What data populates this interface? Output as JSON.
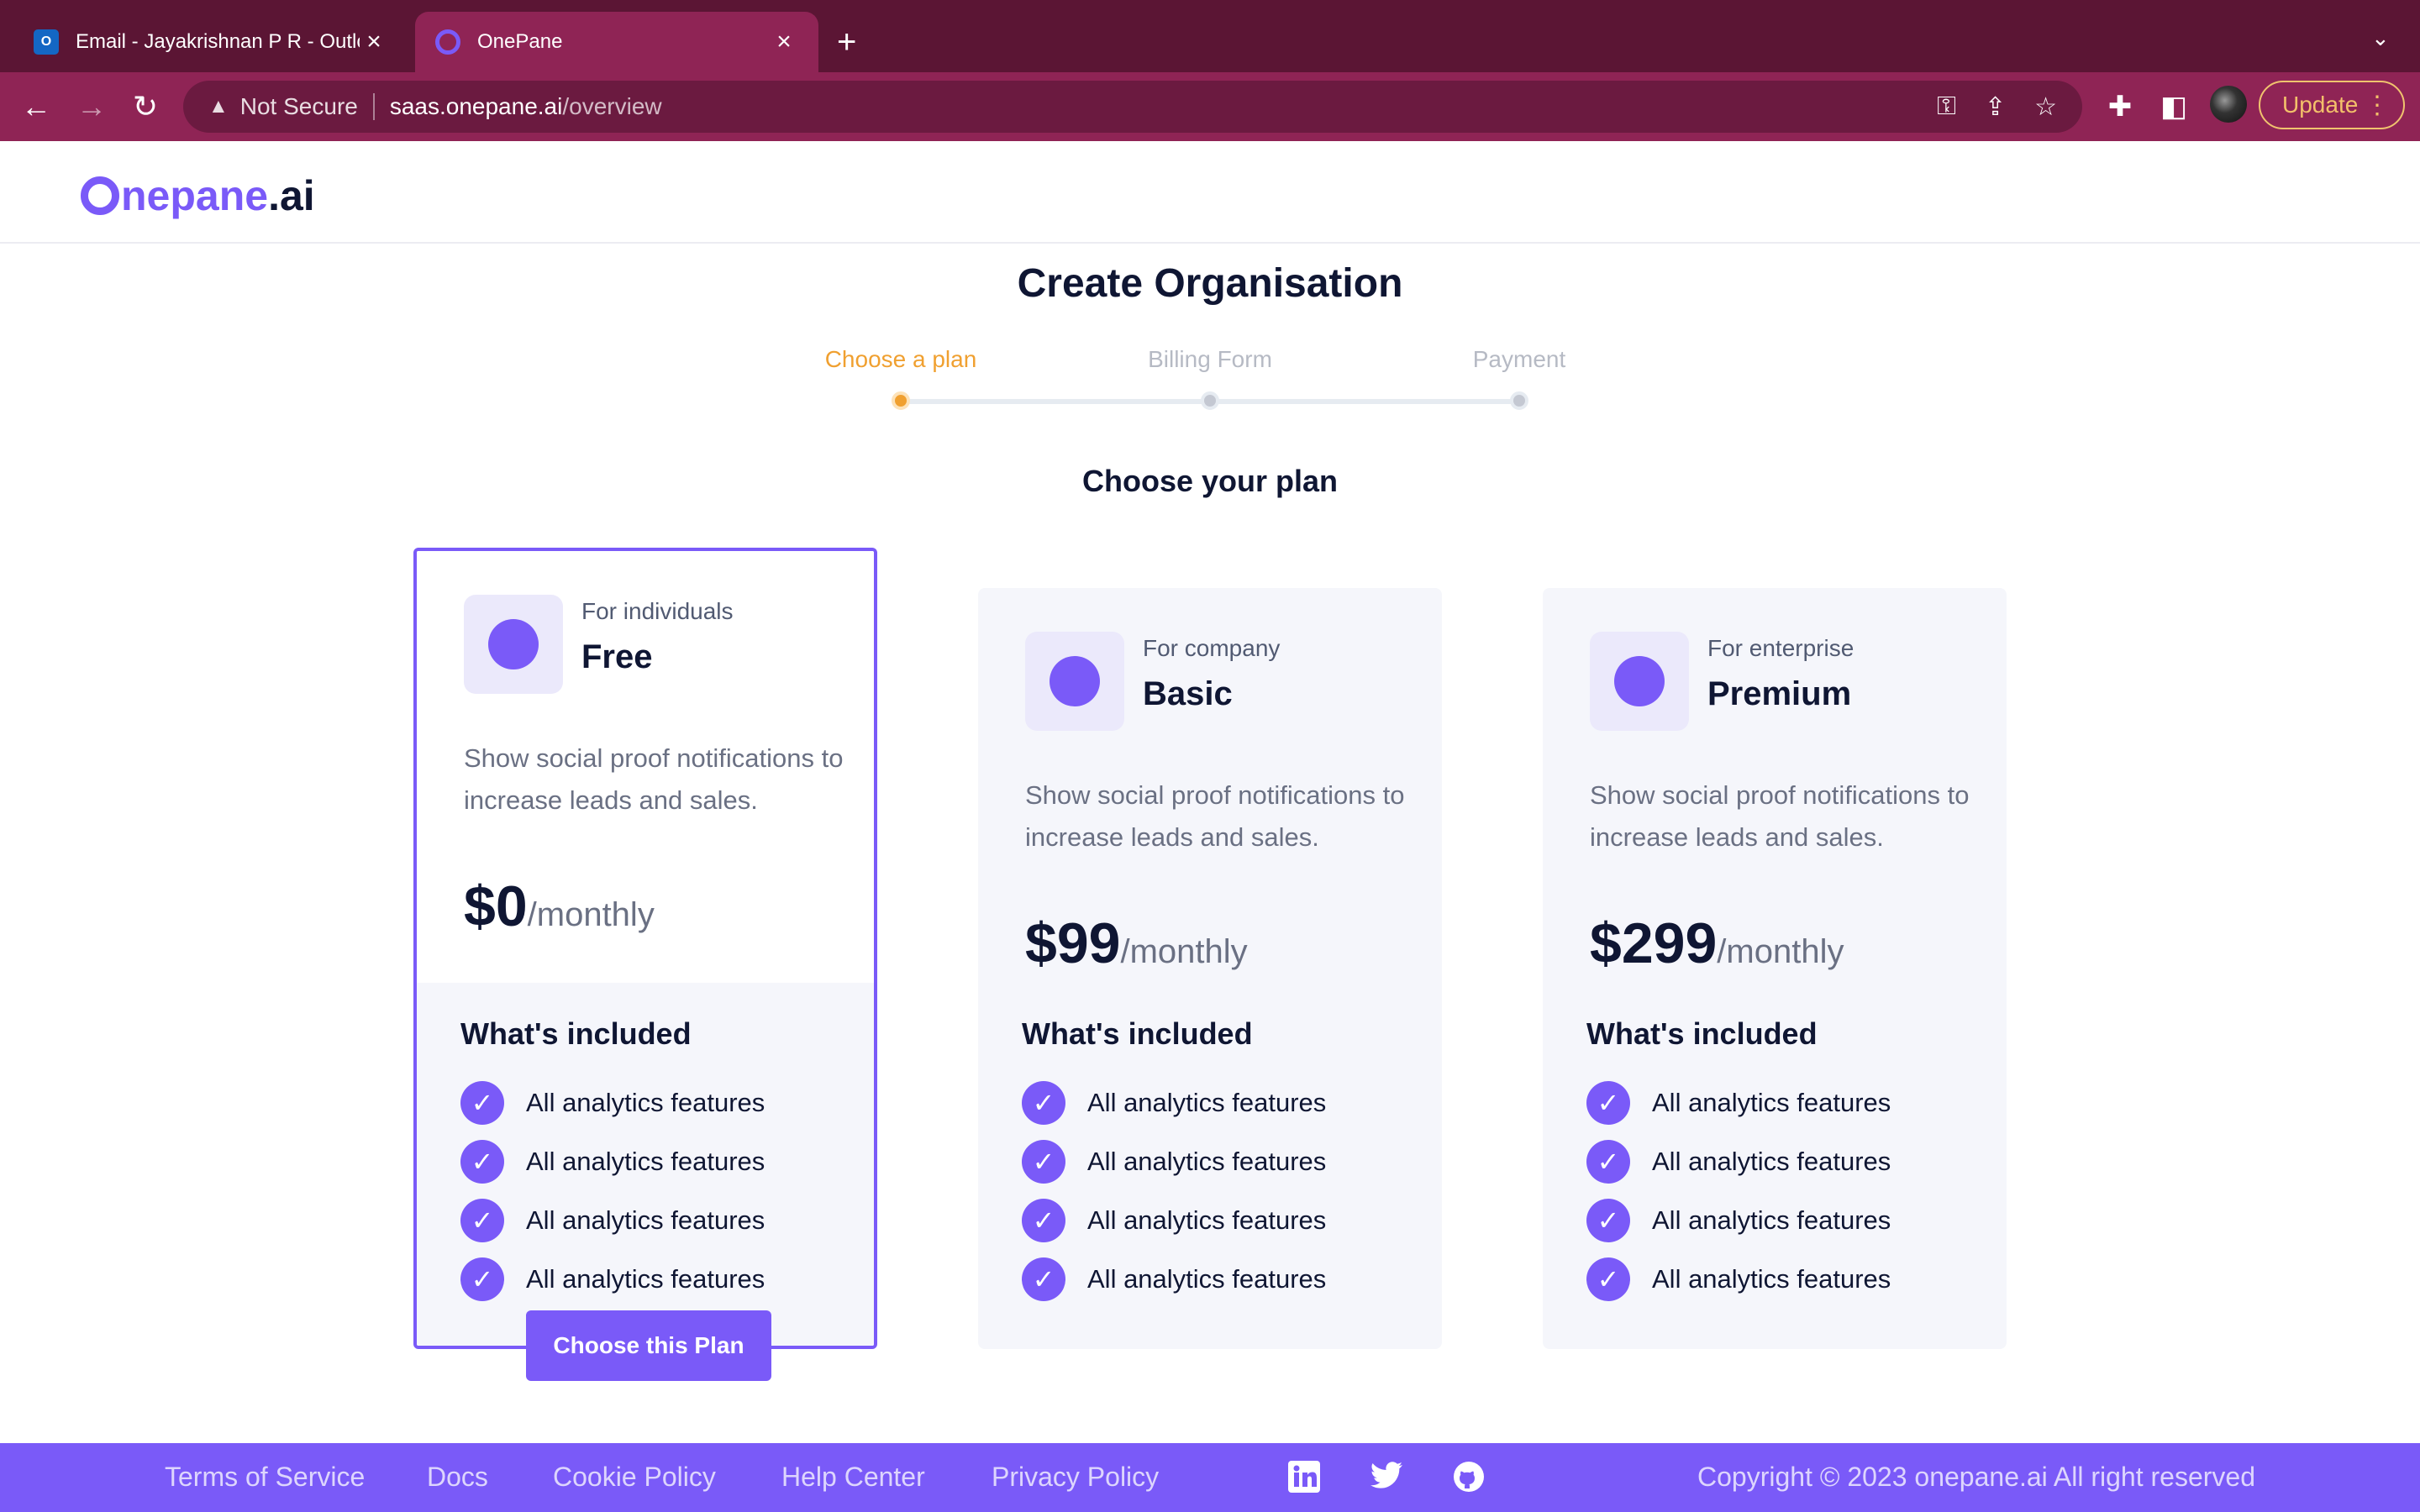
{
  "browser": {
    "tabs": [
      {
        "title": "Email - Jayakrishnan P R - Outlook",
        "active": false,
        "icon": "outlook-icon"
      },
      {
        "title": "OnePane",
        "active": true,
        "icon": "onepane-icon"
      }
    ],
    "new_tab_symbol": "+",
    "security_label": "Not Secure",
    "url_domain": "saas.onepane.ai",
    "url_path": "/overview",
    "update_label": "Update"
  },
  "app": {
    "logo_main": "nepane",
    "logo_suffix": ".ai"
  },
  "page": {
    "title": "Create Organisation",
    "steps": [
      {
        "label": "Choose a plan",
        "state": "active"
      },
      {
        "label": "Billing Form",
        "state": "pending"
      },
      {
        "label": "Payment",
        "state": "pending"
      }
    ],
    "subtitle": "Choose your plan"
  },
  "plans": [
    {
      "audience": "For individuals",
      "name": "Free",
      "description": "Show social proof notifications to increase leads and sales.",
      "price": "$0",
      "period": "/monthly",
      "included_title": "What's included",
      "features": [
        "All analytics features",
        "All analytics features",
        "All analytics features",
        "All analytics features"
      ],
      "selected": true,
      "cta": "Choose this Plan"
    },
    {
      "audience": "For company",
      "name": "Basic",
      "description": "Show social proof notifications to increase leads and sales.",
      "price": "$99",
      "period": "/monthly",
      "included_title": "What's included",
      "features": [
        "All analytics features",
        "All analytics features",
        "All analytics features",
        "All analytics features"
      ],
      "selected": false
    },
    {
      "audience": "For enterprise",
      "name": "Premium",
      "description": "Show social proof notifications to increase leads and sales.",
      "price": "$299",
      "period": "/monthly",
      "included_title": "What's included",
      "features": [
        "All analytics features",
        "All analytics features",
        "All analytics features",
        "All analytics features"
      ],
      "selected": false
    }
  ],
  "footer": {
    "links": [
      "Terms of Service",
      "Docs",
      "Cookie Policy",
      "Help Center",
      "Privacy Policy"
    ],
    "social": [
      "linkedin-icon",
      "twitter-icon",
      "github-icon"
    ],
    "copyright": "Copyright © 2023 onepane.ai All right reserved"
  },
  "colors": {
    "accent": "#7a5af8",
    "step_active": "#f0a030",
    "step_pending": "#c4c8d2",
    "tabbar": "#5b1534",
    "toolbar": "#8f2455"
  }
}
